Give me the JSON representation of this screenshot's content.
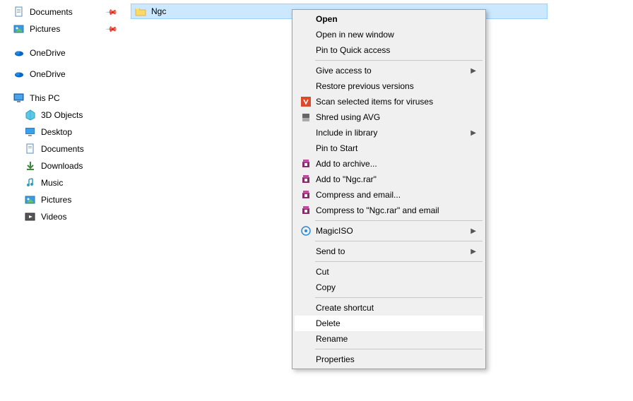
{
  "sidebar": {
    "pinned": [
      {
        "label": "Documents",
        "icon": "documents-icon",
        "pinned": true
      },
      {
        "label": "Pictures",
        "icon": "pictures-icon",
        "pinned": true
      }
    ],
    "cloud": [
      {
        "label": "OneDrive",
        "icon": "onedrive-icon"
      },
      {
        "label": "OneDrive",
        "icon": "onedrive-icon"
      }
    ],
    "thispc": {
      "label": "This PC",
      "icon": "thispc-icon"
    },
    "thispc_children": [
      {
        "label": "3D Objects",
        "icon": "3dobjects-icon"
      },
      {
        "label": "Desktop",
        "icon": "desktop-icon"
      },
      {
        "label": "Documents",
        "icon": "documents-icon"
      },
      {
        "label": "Downloads",
        "icon": "downloads-icon"
      },
      {
        "label": "Music",
        "icon": "music-icon"
      },
      {
        "label": "Pictures",
        "icon": "pictures-icon"
      },
      {
        "label": "Videos",
        "icon": "videos-icon"
      }
    ]
  },
  "main": {
    "selected_folder": "Ngc"
  },
  "context_menu": {
    "items": [
      {
        "label": "Open",
        "bold": true
      },
      {
        "label": "Open in new window"
      },
      {
        "label": "Pin to Quick access"
      },
      {
        "sep": true
      },
      {
        "label": "Give access to",
        "submenu": true
      },
      {
        "label": "Restore previous versions"
      },
      {
        "label": "Scan selected items for viruses",
        "icon": "avg-icon"
      },
      {
        "label": "Shred using AVG",
        "icon": "shred-icon"
      },
      {
        "label": "Include in library",
        "submenu": true
      },
      {
        "label": "Pin to Start"
      },
      {
        "label": "Add to archive...",
        "icon": "winrar-icon"
      },
      {
        "label": "Add to \"Ngc.rar\"",
        "icon": "winrar-icon"
      },
      {
        "label": "Compress and email...",
        "icon": "winrar-icon"
      },
      {
        "label": "Compress to \"Ngc.rar\" and email",
        "icon": "winrar-icon"
      },
      {
        "sep": true
      },
      {
        "label": "MagicISO",
        "icon": "magiciso-icon",
        "submenu": true
      },
      {
        "sep": true
      },
      {
        "label": "Send to",
        "submenu": true
      },
      {
        "sep": true
      },
      {
        "label": "Cut"
      },
      {
        "label": "Copy"
      },
      {
        "sep": true
      },
      {
        "label": "Create shortcut"
      },
      {
        "label": "Delete",
        "highlight": true
      },
      {
        "label": "Rename"
      },
      {
        "sep": true
      },
      {
        "label": "Properties"
      }
    ]
  }
}
